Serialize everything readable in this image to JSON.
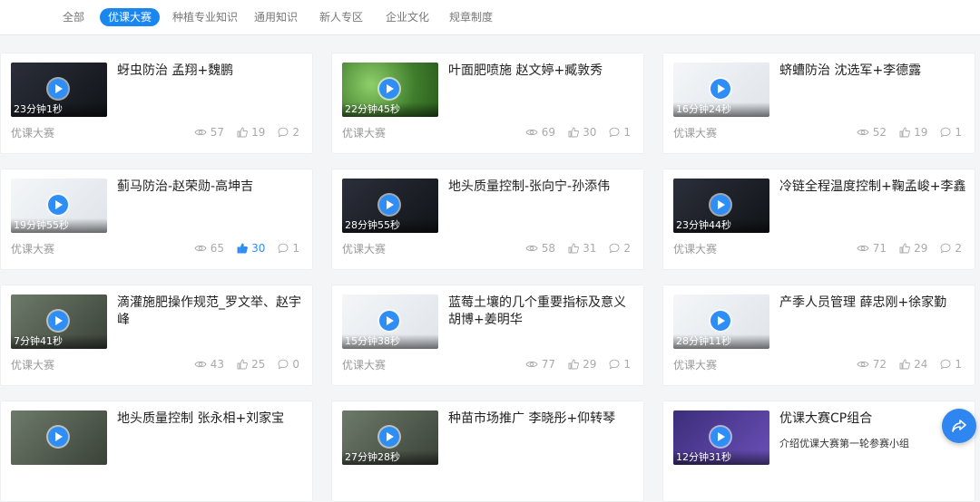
{
  "tabs": [
    "全部",
    "优课大赛",
    "种植专业知识",
    "通用知识",
    "新人专区",
    "企业文化",
    "规章制度"
  ],
  "active_tab": "优课大赛",
  "cards": [
    {
      "title": "蚜虫防治 孟翔+魏鹏",
      "subtitle": "",
      "duration": "23分钟1秒",
      "tag": "优课大赛",
      "views": "57",
      "likes": "19",
      "comments": "2",
      "thumb": "dark"
    },
    {
      "title": "叶面肥喷施 赵文婷+臧敦秀",
      "subtitle": "",
      "duration": "22分钟45秒",
      "tag": "优课大赛",
      "views": "69",
      "likes": "30",
      "comments": "1",
      "thumb": "green"
    },
    {
      "title": "蛴螬防治 沈选军+李德露",
      "subtitle": "",
      "duration": "16分钟24秒",
      "tag": "优课大赛",
      "views": "52",
      "likes": "19",
      "comments": "1",
      "thumb": "light"
    },
    {
      "title": "蓟马防治-赵荣勋-高坤吉",
      "subtitle": "",
      "duration": "19分钟55秒",
      "tag": "优课大赛",
      "views": "65",
      "likes": "30",
      "comments": "1",
      "thumb": "light",
      "liked": true
    },
    {
      "title": "地头质量控制-张向宁-孙添伟",
      "subtitle": "",
      "duration": "28分钟55秒",
      "tag": "优课大赛",
      "views": "58",
      "likes": "31",
      "comments": "2",
      "thumb": "dark"
    },
    {
      "title": "冷链全程温度控制+鞠孟峻+李鑫",
      "subtitle": "",
      "duration": "23分钟44秒",
      "tag": "优课大赛",
      "views": "71",
      "likes": "29",
      "comments": "2",
      "thumb": "dark"
    },
    {
      "title": "滴灌施肥操作规范_罗文举、赵宇峰",
      "subtitle": "",
      "duration": "7分钟41秒",
      "tag": "优课大赛",
      "views": "43",
      "likes": "25",
      "comments": "0",
      "thumb": "photo"
    },
    {
      "title": "蓝莓土壤的几个重要指标及意义 胡博+姜明华",
      "subtitle": "",
      "duration": "15分钟38秒",
      "tag": "优课大赛",
      "views": "77",
      "likes": "29",
      "comments": "1",
      "thumb": "light"
    },
    {
      "title": "产季人员管理 薛忠刚+徐家勤",
      "subtitle": "",
      "duration": "28分钟11秒",
      "tag": "优课大赛",
      "views": "72",
      "likes": "24",
      "comments": "1",
      "thumb": "light"
    },
    {
      "title": "地头质量控制 张永相+刘家宝",
      "subtitle": "",
      "duration": "",
      "tag": "",
      "views": "",
      "likes": "",
      "comments": "",
      "thumb": "photo"
    },
    {
      "title": "种苗市场推广 李晓彤+仰转琴",
      "subtitle": "",
      "duration": "27分钟28秒",
      "tag": "",
      "views": "",
      "likes": "",
      "comments": "",
      "thumb": "photo"
    },
    {
      "title": "优课大赛CP组合",
      "subtitle": "介绍优课大赛第一轮参赛小组",
      "duration": "12分钟31秒",
      "tag": "",
      "views": "",
      "likes": "",
      "comments": "",
      "thumb": "purple"
    }
  ],
  "colors": {
    "accent": "#1a86f0",
    "liked": "#2f8ef5"
  }
}
